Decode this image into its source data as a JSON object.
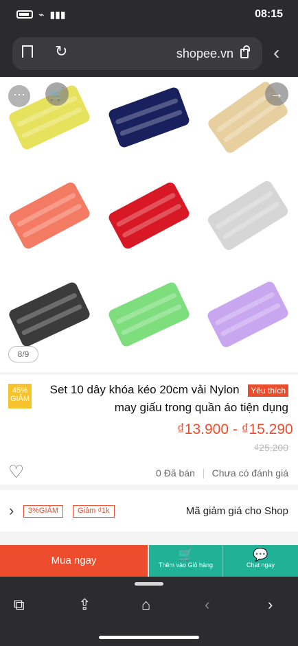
{
  "status": {
    "time": "08:15",
    "icons": [
      "battery-icon",
      "wifi-icon",
      "signal-icon"
    ]
  },
  "browser": {
    "url": "shopee.vn",
    "icons": [
      "bookmark-icon",
      "refresh-icon",
      "lock-icon",
      "back-icon"
    ],
    "toolbar_icons": [
      "tabs-icon",
      "share-icon",
      "home-icon",
      "back-arrow-icon",
      "forward-arrow-icon"
    ]
  },
  "gallery": {
    "page_indicator": "8/9",
    "thumbnail_colors": [
      "#e7e25d",
      "#18205d",
      "#e8cf9f",
      "#f47b63",
      "#d81824",
      "#d6d6d6",
      "#3b3b3b",
      "#7edd7d",
      "#c8a7f0"
    ]
  },
  "product": {
    "discount_badge_line1": "45%",
    "discount_badge_line2": "GIẢM",
    "favorite_tag": "Yêu thích",
    "title_line1": "Set 10 dây khóa kéo 20cm vải Nylon",
    "title_line2": "may giấu trong quần áo tiện dụng",
    "price": "₫13.900 - ₫15.290",
    "old_price": "₫25.200",
    "rating_status": "Chưa có đánh giá",
    "sold": "0 Đã bán"
  },
  "voucher": {
    "label": "Mã giảm giá cho Shop",
    "chip1": "3%GIẢM",
    "chip2": "Giảm ₫1k"
  },
  "actions": {
    "buy_now": "Mua ngay",
    "add_to_cart": "Thêm vào Giỏ hàng",
    "chat": "Chat ngay"
  },
  "colors": {
    "accent": "#ee4d2d",
    "teal": "#20b197",
    "dark": "#2b2b2d"
  }
}
